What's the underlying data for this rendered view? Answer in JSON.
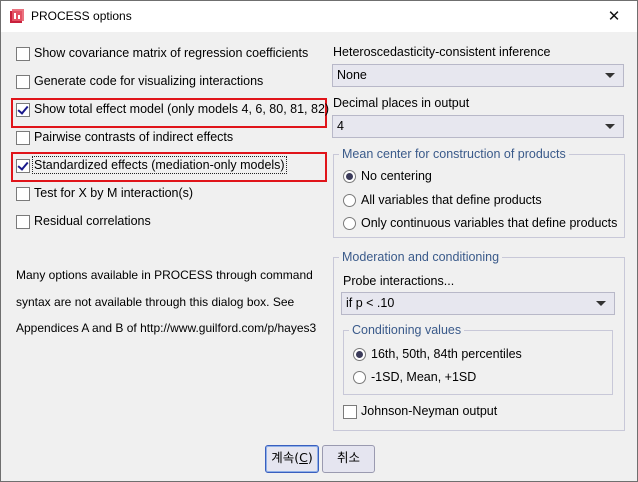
{
  "window": {
    "title": "PROCESS options",
    "close_glyph": "✕"
  },
  "left": {
    "checkboxes": [
      {
        "label": "Show covariance matrix of regression coefficients",
        "checked": false
      },
      {
        "label": "Generate code for visualizing interactions",
        "checked": false
      },
      {
        "label": "Show total effect model (only models 4, 6, 80, 81, 82)",
        "checked": true
      },
      {
        "label": "Pairwise contrasts of indirect effects",
        "checked": false
      },
      {
        "label": "Standardized effects (mediation-only models)",
        "checked": true
      },
      {
        "label": "Test for X by M interaction(s)",
        "checked": false
      },
      {
        "label": "Residual correlations",
        "checked": false
      }
    ],
    "help_lines": [
      "Many options available in PROCESS through command",
      "syntax are not available through this dialog box.  See",
      "Appendices A and B of http://www.guilford.com/p/hayes3"
    ]
  },
  "right": {
    "hc_label": "Heteroscedasticity-consistent inference",
    "hc_value": "None",
    "decimal_label": "Decimal places in output",
    "decimal_value": "4",
    "mean_center": {
      "title": "Mean center for construction of products",
      "options": [
        {
          "label": "No centering",
          "selected": true
        },
        {
          "label": "All variables that define products",
          "selected": false
        },
        {
          "label": "Only continuous variables that define products",
          "selected": false
        }
      ]
    },
    "moderation": {
      "title": "Moderation and conditioning",
      "probe_label": "Probe interactions...",
      "probe_value": "if p < .10",
      "conditioning": {
        "title": "Conditioning values",
        "options": [
          {
            "label": "16th, 50th, 84th percentiles",
            "selected": true
          },
          {
            "label": "-1SD, Mean, +1SD",
            "selected": false
          }
        ]
      },
      "johnson_neyman": {
        "label": "Johnson-Neyman output",
        "checked": false
      }
    }
  },
  "buttons": {
    "continue_label": "계속(",
    "continue_mnemonic": "C",
    "continue_suffix": ")",
    "cancel_label": "취소"
  },
  "colors": {
    "highlight_red": "#e0141a",
    "group_title": "#3a5a8a",
    "dropdown_bg": "#e7e7ef"
  }
}
